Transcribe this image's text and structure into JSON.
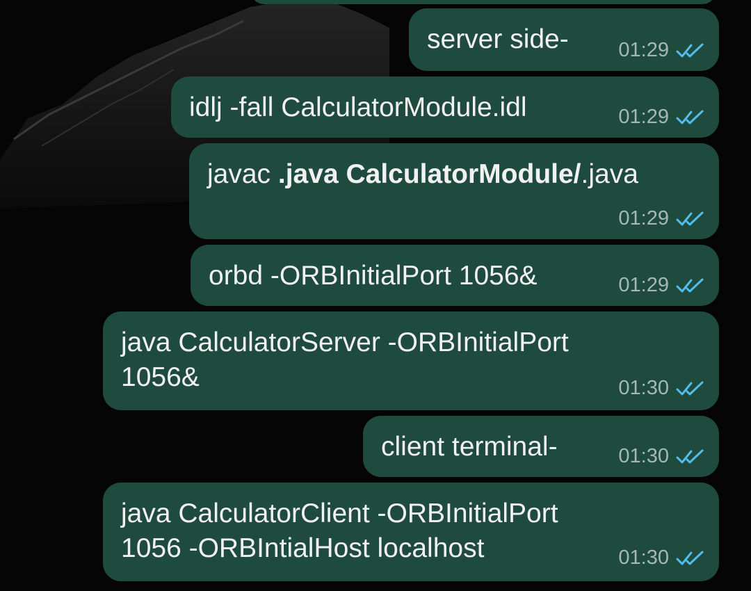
{
  "messages": [
    {
      "text": "server side-",
      "time": "01:29"
    },
    {
      "text": "idlj -fall CalculatorModule.idl",
      "time": "01:29"
    },
    {
      "plain_1": "javac ",
      "bold": ".java CalculatorModule/",
      "plain_2": ".java",
      "time": "01:29"
    },
    {
      "text": "orbd -ORBInitialPort 1056&",
      "time": "01:29"
    },
    {
      "line1": "java CalculatorServer -ORBInitialPort",
      "line2": "1056&",
      "time": "01:30"
    },
    {
      "text": "client terminal-",
      "time": "01:30"
    },
    {
      "line1": "java CalculatorClient -ORBInitialPort",
      "line2": "1056 -ORBIntialHost localhost",
      "time": "01:30"
    }
  ],
  "colors": {
    "bubble": "#1e4b3e",
    "read_ticks": "#53bdeb",
    "timestamp": "#a7b8b2",
    "background": "#050505"
  },
  "icons": {
    "read_receipt": "double-check-icon"
  }
}
